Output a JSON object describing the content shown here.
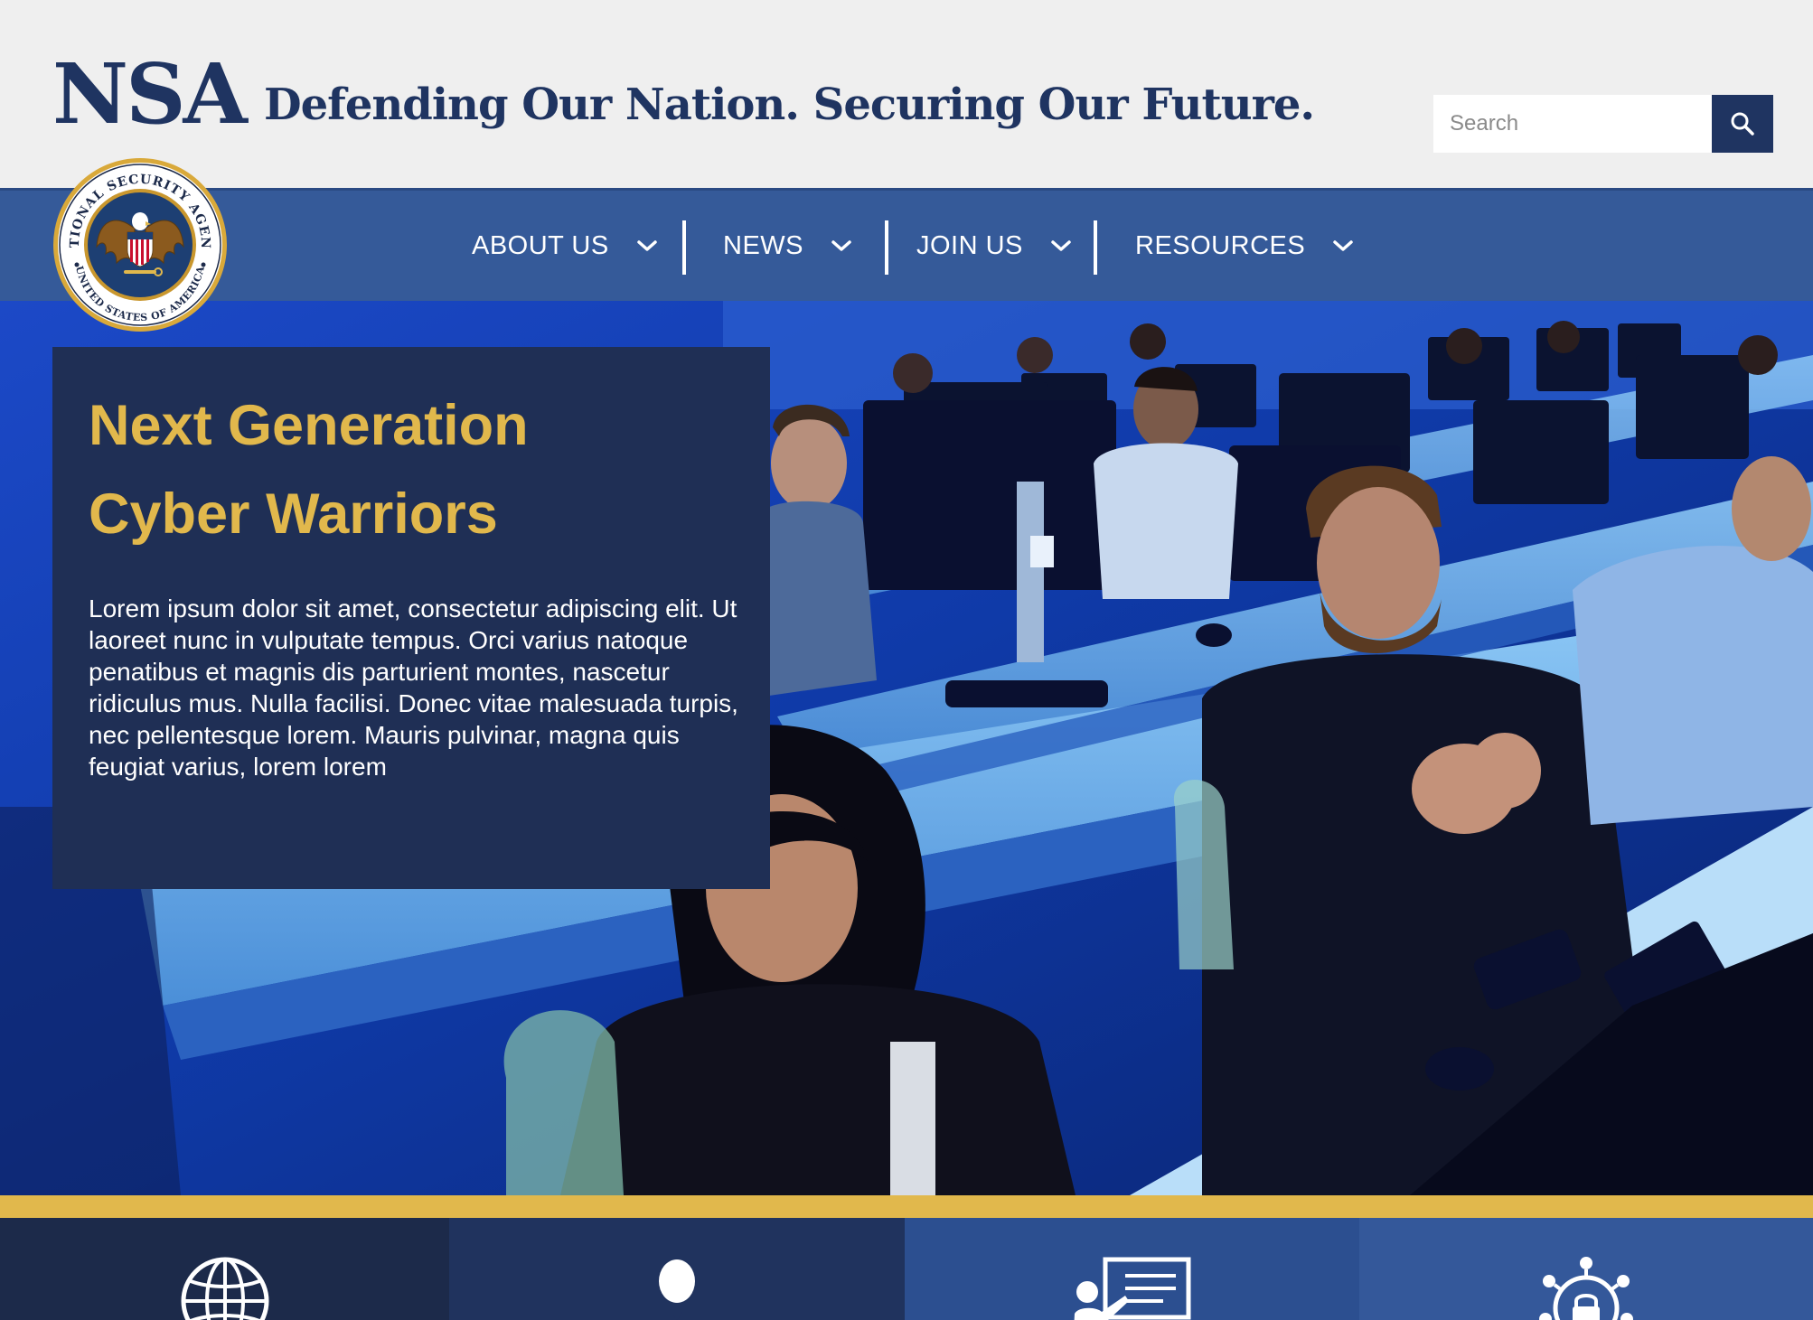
{
  "header": {
    "logo_text": "NSA",
    "tagline": "Defending Our Nation. Securing Our Future.",
    "search": {
      "placeholder": "Search"
    }
  },
  "seal": {
    "text_top": "NATIONAL SECURITY AGENCY",
    "text_bottom": "UNITED STATES OF AMERICA"
  },
  "nav": {
    "items": [
      {
        "label": "ABOUT US"
      },
      {
        "label": "NEWS"
      },
      {
        "label": "JOIN US"
      },
      {
        "label": "RESOURCES"
      }
    ]
  },
  "hero": {
    "title_line1": "Next Generation",
    "title_line2": "Cyber Warriors",
    "body": "Lorem ipsum dolor sit amet, consectetur adipiscing elit. Ut laoreet nunc in vulputate tempus. Orci varius natoque penatibus et magnis dis parturient montes, nascetur ridiculus mus. Nulla facilisi. Donec vitae malesuada turpis, nec pellentesque lorem. Mauris pulvinar, magna quis feugiat varius, lorem lorem"
  },
  "tiles": [
    {
      "icon": "globe-icon",
      "color": "#1c2a4a"
    },
    {
      "icon": "person-icon",
      "color": "#20335e"
    },
    {
      "icon": "presentation-icon",
      "color": "#2c4f90"
    },
    {
      "icon": "network-lock-icon",
      "color": "#34589a"
    }
  ],
  "colors": {
    "navy": "#1f3461",
    "nav_blue": "#355a99",
    "gold": "#e1b84c",
    "card": "#1f2f55"
  }
}
